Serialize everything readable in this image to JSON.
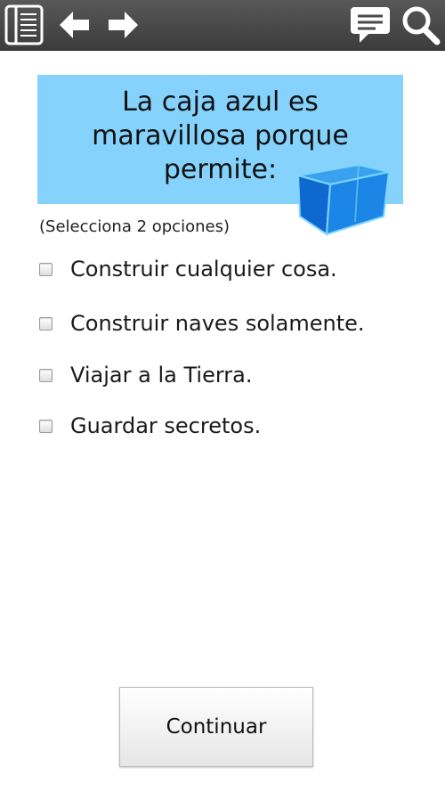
{
  "toolbar": {
    "icons": [
      "menu-list-icon",
      "back-arrow-icon",
      "forward-arrow-icon",
      "comment-icon",
      "search-icon"
    ],
    "background": "#4a4a4a"
  },
  "question": {
    "title": "La caja azul es maravillosa porque permite:",
    "title_lines": [
      "La caja azul es",
      "maravillosa porque",
      "permite:"
    ],
    "banner_color": "#85d3fc",
    "hint": "(Selecciona 2 opciones)"
  },
  "options": [
    {
      "label": "Construir cualquier cosa.",
      "checked": false
    },
    {
      "label": "Construir naves solamente.",
      "checked": false
    },
    {
      "label": "Viajar a la Tierra.",
      "checked": false
    },
    {
      "label": "Guardar secretos.",
      "checked": false
    }
  ],
  "continue_label": "Continuar"
}
